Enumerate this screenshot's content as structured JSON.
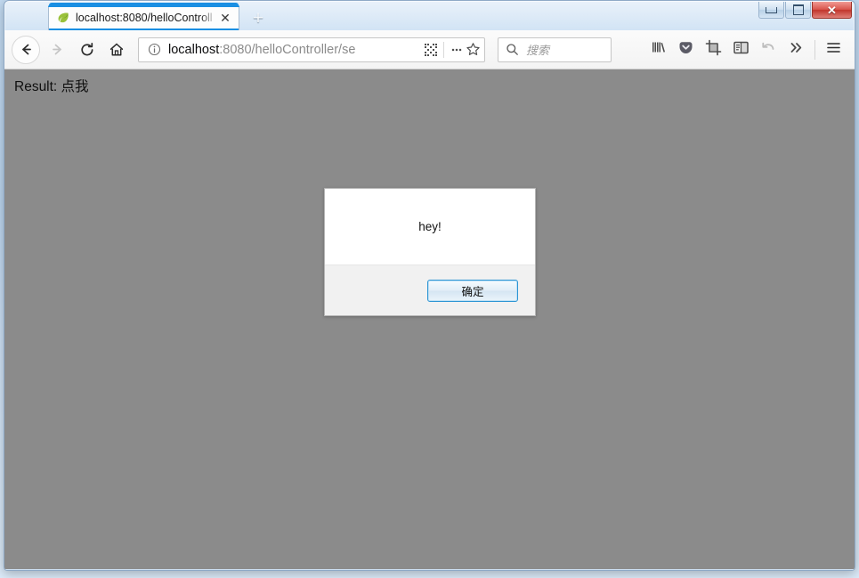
{
  "window": {
    "caption_buttons": [
      {
        "name": "minimize",
        "glyph": "minimize-icon"
      },
      {
        "name": "restore",
        "glyph": "restore-icon"
      },
      {
        "name": "close",
        "glyph": "✕"
      }
    ]
  },
  "tabstrip": {
    "tab": {
      "title": "localhost:8080/helloControll",
      "favicon": "leaf-icon",
      "close_label": "✕"
    },
    "new_tab_label": "+"
  },
  "navbar": {
    "back_title": "back-icon",
    "forward_title": "forward-icon",
    "reload_title": "reload-icon",
    "home_title": "home-icon",
    "url": {
      "host": "localhost",
      "path": ":8080/helloController/se",
      "identity_icon": "info-icon",
      "qr_icon": "qr-code-icon",
      "menu_icon": "ellipsis-icon",
      "bookmark_icon": "star-icon"
    },
    "search": {
      "placeholder": "搜索",
      "icon": "search-icon"
    },
    "right_icons": [
      "library-icon",
      "pocket-icon",
      "screenshot-icon",
      "reader-view-icon",
      "undo-icon",
      "overflow-chevrons-icon",
      "hamburger-menu-icon"
    ]
  },
  "page": {
    "result_text": "Result: 点我",
    "background_color": "#8b8b8b"
  },
  "dialog": {
    "message": "hey!",
    "ok_label": "确定",
    "accent_color": "#2d95d4",
    "body_bg": "#ffffff",
    "footer_bg": "#f1f1f1"
  },
  "desktop": {
    "blurred_text_1": "  ",
    "blurred_text_2": "  "
  }
}
